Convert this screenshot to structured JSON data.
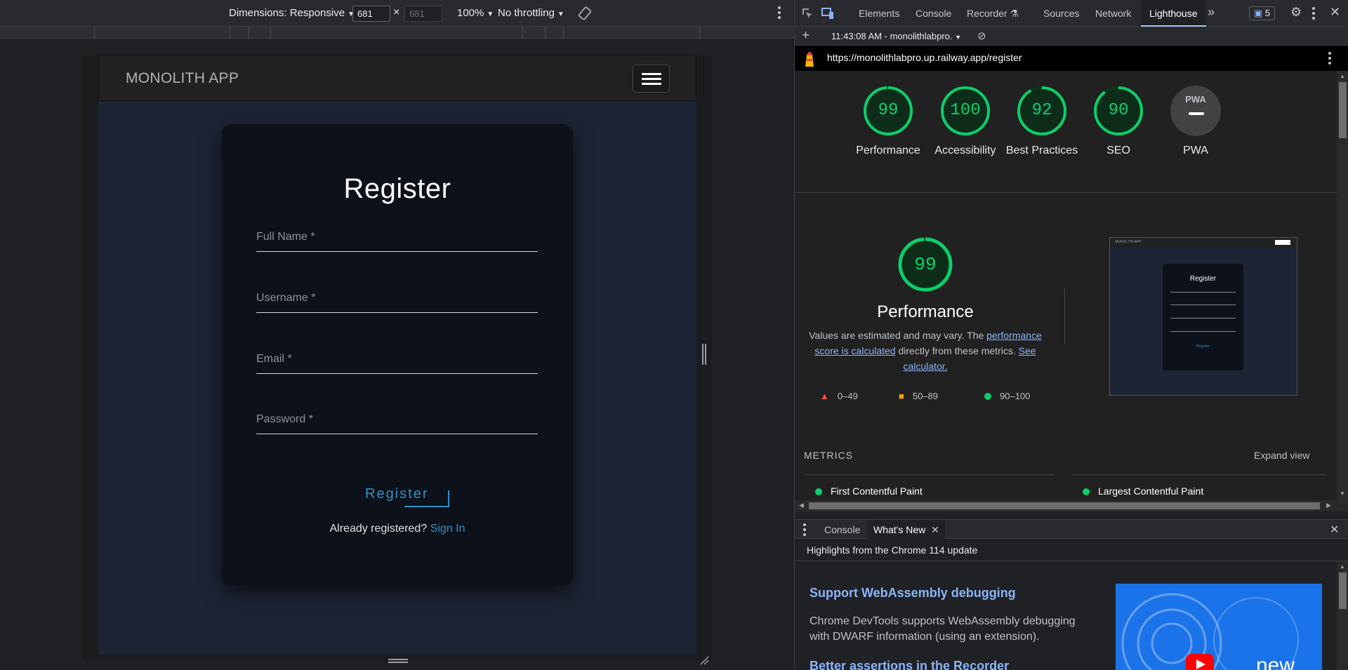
{
  "device_toolbar": {
    "dimensions_label": "Dimensions: Responsive",
    "width": "681",
    "height": "681",
    "zoom": "100%",
    "throttling": "No throttling"
  },
  "app": {
    "brand": "MONOLITH APP",
    "form_title": "Register",
    "fields": {
      "full_name": "Full Name *",
      "username": "Username *",
      "email": "Email *",
      "password": "Password *"
    },
    "register_button": "Register",
    "already_text": "Already registered?",
    "signin_link": "Sign In"
  },
  "devtools": {
    "tabs": [
      "Elements",
      "Console",
      "Recorder",
      "Sources",
      "Network",
      "Lighthouse"
    ],
    "issues_count": "5",
    "report_time": "11:43:08 AM - monolithlabpro.",
    "url": "https://monolithlabpro.up.railway.app/register"
  },
  "lighthouse": {
    "scores": [
      {
        "label": "Performance",
        "value": "99",
        "fraction": 0.99
      },
      {
        "label": "Accessibility",
        "value": "100",
        "fraction": 1.0
      },
      {
        "label": "Best Practices",
        "value": "92",
        "fraction": 0.92
      },
      {
        "label": "SEO",
        "value": "90",
        "fraction": 0.9
      },
      {
        "label": "PWA",
        "value": "PWA"
      }
    ],
    "perf_score": "99",
    "perf_fraction": 0.99,
    "perf_title": "Performance",
    "perf_desc_1": "Values are estimated and may vary. The ",
    "perf_link_1": "performance score is calculated",
    "perf_desc_2": " directly from these metrics. ",
    "perf_link_2": "See calculator.",
    "legend": {
      "low": "0–49",
      "mid": "50–89",
      "high": "90–100"
    },
    "thumbnail": {
      "brand": "MONOLITH APP",
      "title": "Register",
      "button": "Register"
    },
    "metrics_label": "METRICS",
    "expand_label": "Expand view",
    "metrics": [
      "First Contentful Paint",
      "Largest Contentful Paint"
    ]
  },
  "drawer": {
    "tabs": [
      "Console",
      "What's New"
    ],
    "highlights": "Highlights from the Chrome 114 update",
    "heading1": "Support WebAssembly debugging",
    "body1": "Chrome DevTools supports WebAssembly debugging with DWARF information (using an extension).",
    "heading2": "Better assertions in the Recorder",
    "video_text": "new"
  },
  "colors": {
    "pass": "#0cce6b",
    "accent": "#2f92c7",
    "link": "#8ab4f8"
  }
}
